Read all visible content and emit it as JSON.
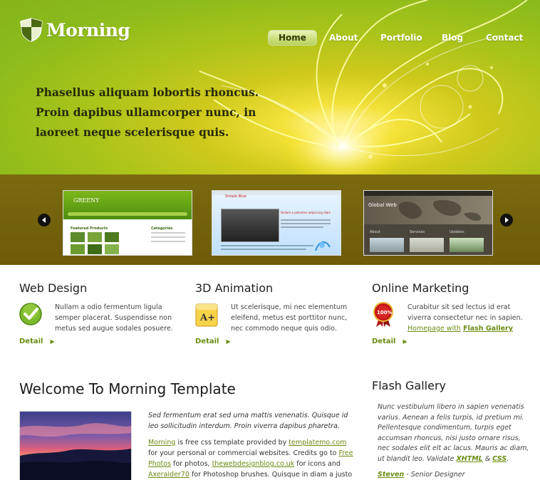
{
  "brand": {
    "name": "Morning"
  },
  "nav": {
    "items": [
      "Home",
      "About",
      "Portfolio",
      "Blog",
      "Contact"
    ],
    "active": "Home"
  },
  "banner": {
    "tagline": "Phasellus aliquam lobortis rhoncus. Proin dapibus ullamcorper nunc, in laoreet neque scelerisque quis."
  },
  "gallery": {
    "thumb1": {
      "title": "GREENY",
      "heading1": "Featured Products",
      "heading2": "Categories"
    },
    "thumb2": {
      "title": "Simple Blue",
      "heading": "Nullam a pellentes adipiscing diam"
    },
    "thumb3": {
      "title": "Global Web",
      "cols": [
        "About",
        "Services",
        "Updates"
      ]
    }
  },
  "services": [
    {
      "title": "Web Design",
      "text": "Nullam a odio fermentum ligula semper placerat. Suspendisse non metus sed augue sodales posuere.",
      "detail": "Detail",
      "icon": "checkmark-icon"
    },
    {
      "title": "3D Animation",
      "text": "Ut scelerisque, mi nec elementum eleifend, metus est porttitor nunc, nec commodo neque quis odio.",
      "detail": "Detail",
      "icon": "grade-a-plus-icon"
    },
    {
      "title": "Online Marketing",
      "text_pre": "Curabitur sit sed lectus id erat viverra consectetur nec in sapien. ",
      "link1": "Homepage with",
      "link2": "Flash Gallery",
      "detail": "Detail",
      "icon": "guarantee-badge-icon",
      "badge_text": "100%"
    }
  ],
  "welcome": {
    "title": "Welcome To Morning Template",
    "intro": "Sed fermentum erat sed urna mattis venenatis. Quisque id leo sollicitudin interdum. Proin viverra dapibus pharetra.",
    "p2": {
      "link_morning": "Morning",
      "t1": " is free css template provided by ",
      "link_tm": "templatemo.com",
      "t2": " for your personal or commercial websites. Credits go to ",
      "link_free": "Free Photos",
      "t3": " for photos, ",
      "link_twd": "thewebdesignblog.co.uk",
      "t4": " for icons and ",
      "link_ax": "Axeraider70",
      "t5": " for Photoshop brushes. Quisque in diam a justo"
    }
  },
  "flash": {
    "title": "Flash Gallery",
    "text": "Nunc vestibulum libero in sapien venenatis varius. Aenean a felis turpis, id pretium mi. Pellentesque condimentum, turpis eget accumsan rhoncus, nisi justo ornare risus, nec sodales elit elt ac lacus. Mauris ac diam, ut blandit leo. Validate ",
    "xhtml": "XHTML",
    "amp": " & ",
    "css": "CSS",
    "end": ".",
    "author": "Steven",
    "role": " - Senior Designer"
  },
  "colors": {
    "accent": "#6b8b12",
    "header_green": "#9bc01a",
    "band": "#735f0b"
  }
}
